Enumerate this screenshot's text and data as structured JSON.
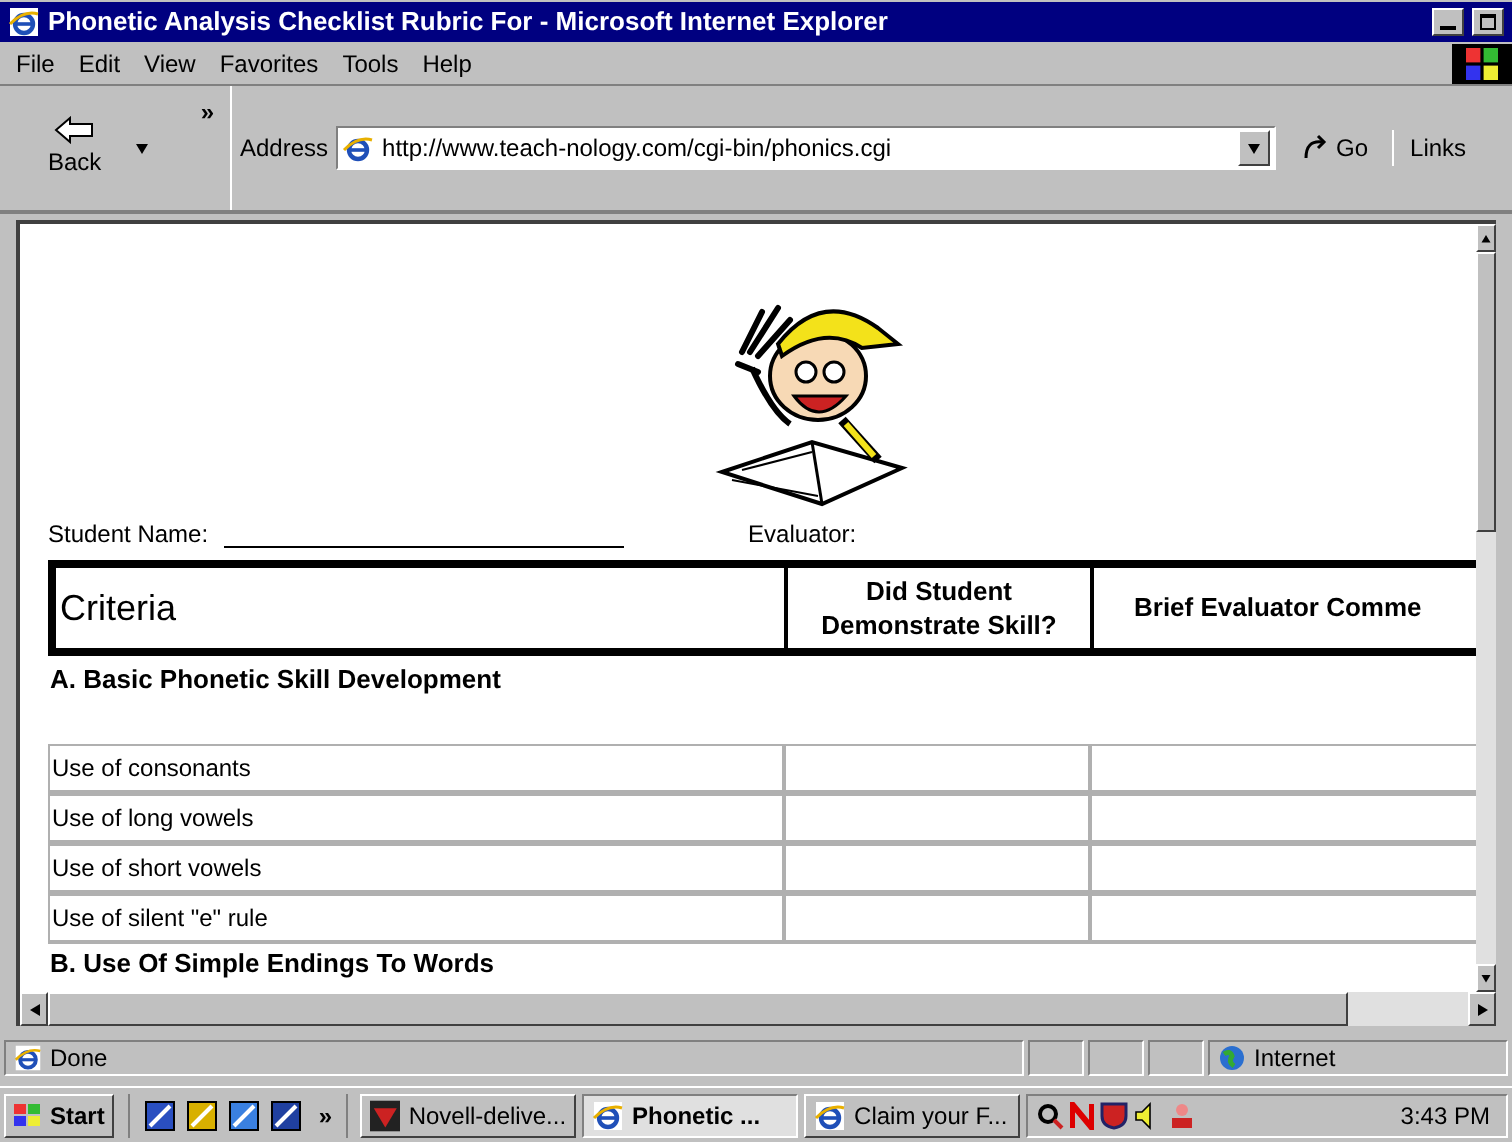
{
  "window": {
    "title": "Phonetic Analysis Checklist Rubric For - Microsoft Internet Explorer"
  },
  "menu": [
    "File",
    "Edit",
    "View",
    "Favorites",
    "Tools",
    "Help"
  ],
  "toolbar": {
    "back": "Back",
    "chevron": "»",
    "address_label": "Address",
    "url": "http://www.teach-nology.com/cgi-bin/phonics.cgi",
    "go": "Go",
    "links": "Links"
  },
  "page": {
    "student_label": "Student Name:",
    "evaluator_label": "Evaluator:",
    "columns": [
      "Criteria",
      "Did Student Demonstrate Skill?",
      "Brief Evaluator Comme"
    ],
    "sections": [
      {
        "title": "A. Basic Phonetic Skill Development",
        "rows": [
          "Use of consonants",
          "Use of long vowels",
          "Use of short vowels",
          "Use of silent \"e\" rule"
        ]
      },
      {
        "title": "B. Use Of Simple Endings To Words"
      }
    ]
  },
  "status_bar": {
    "text": "Done",
    "zone": "Internet"
  },
  "taskbar": {
    "start": "Start",
    "chevron": "»",
    "tasks": [
      {
        "label": "Novell-delive...",
        "selected": false,
        "kind": "novell"
      },
      {
        "label": "Phonetic ...",
        "selected": true,
        "kind": "ie"
      },
      {
        "label": "Claim your F...",
        "selected": false,
        "kind": "ie"
      }
    ],
    "time": "3:43 PM"
  }
}
